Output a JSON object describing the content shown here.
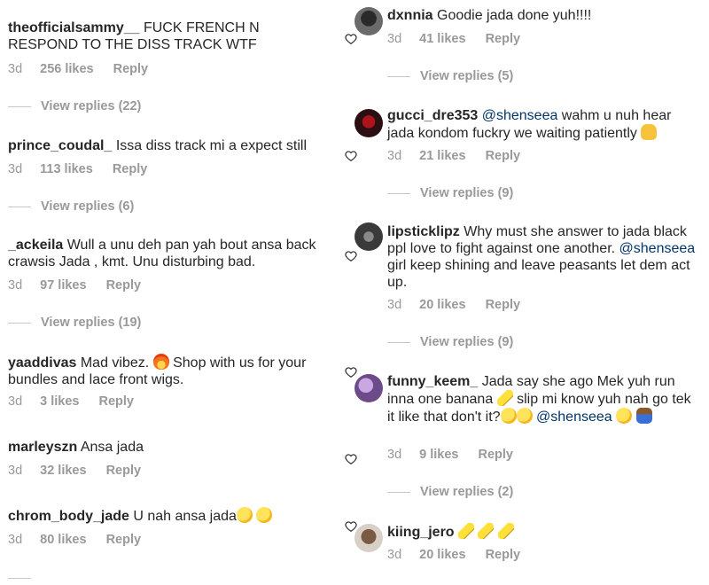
{
  "left_comments": [
    {
      "user": "theofficialsammy__",
      "text": " FUCK FRENCH N RESPOND TO THE DISS TRACK WTF",
      "time": "3d",
      "likes": "256 likes",
      "reply": "Reply",
      "view_replies": "View replies (22)"
    },
    {
      "user": "prince_coudal_",
      "text": " Issa diss track mi a expect still",
      "time": "3d",
      "likes": "113 likes",
      "reply": "Reply",
      "view_replies": "View replies (6)"
    },
    {
      "user": "_ackeila",
      "text": " Wull a unu deh pan yah bout ansa back crawsis Jada , kmt. Unu disturbing bad.",
      "time": "3d",
      "likes": "97 likes",
      "reply": "Reply",
      "view_replies": "View replies (19)"
    },
    {
      "user": "yaaddivas",
      "text_a": " Mad vibez. ",
      "text_b": " Shop with us for your bundles and lace front wigs.",
      "time": "3d",
      "likes": "3 likes",
      "reply": "Reply"
    },
    {
      "user": "marleyszn",
      "text": " Ansa jada",
      "time": "3d",
      "likes": "32 likes",
      "reply": "Reply"
    },
    {
      "user": "chrom_body_jade",
      "text": " U nah ansa jada",
      "time": "3d",
      "likes": "80 likes",
      "reply": "Reply"
    }
  ],
  "right_comments": [
    {
      "user": "dxnnia",
      "text": " Goodie jada done yuh!!!!",
      "time": "3d",
      "likes": "41 likes",
      "reply": "Reply",
      "view_replies": "View replies (5)"
    },
    {
      "user": "gucci_dre353",
      "mention": " @shenseea",
      "text": " wahm u nuh hear jada kondom fuckry we waiting patiently ",
      "time": "3d",
      "likes": "21 likes",
      "reply": "Reply",
      "view_replies": "View replies (9)"
    },
    {
      "user": "lipsticklipz",
      "text": " Why must she answer to jada black ppl love to fight against one another. ",
      "mention": "@shenseea",
      "text_b": " girl keep shining and leave peasants let dem act up.",
      "time": "3d",
      "likes": "20 likes",
      "reply": "Reply",
      "view_replies": "View replies (9)"
    },
    {
      "user": "funny_keem_",
      "text": " Jada say she ago Mek yuh run inna one banana ",
      "text_b": " slip mi know yuh nah go tek it like that don't it?",
      "mention": " @shenseea",
      "time": "3d",
      "likes": "9 likes",
      "reply": "Reply",
      "view_replies": "View replies (2)"
    },
    {
      "user": "kiing_jero",
      "time": "3d",
      "likes": "20 likes",
      "reply": "Reply"
    }
  ],
  "colors": {
    "text": "#262626",
    "muted": "#999999",
    "mention": "#003569",
    "divider": "#c7c7c7"
  }
}
